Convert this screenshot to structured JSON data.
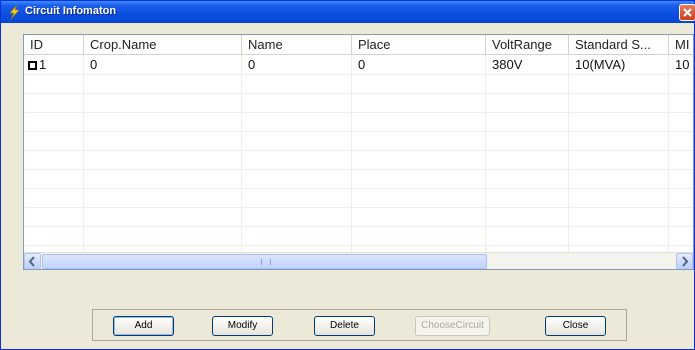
{
  "window": {
    "title": "Circuit Infomaton"
  },
  "grid": {
    "columns": [
      "ID",
      "Crop.Name",
      "Name",
      "Place",
      "VoltRange",
      "Standard S...",
      "MI"
    ],
    "rows": [
      {
        "id": "1",
        "crop_name": "0",
        "name": "0",
        "place": "0",
        "volt_range": "380V",
        "standard": "10(MVA)",
        "mi": "10"
      }
    ]
  },
  "buttons": {
    "add": "Add",
    "modify": "Modify",
    "delete": "Delete",
    "choose_circuit": "ChooseCircuit",
    "close": "Close"
  }
}
